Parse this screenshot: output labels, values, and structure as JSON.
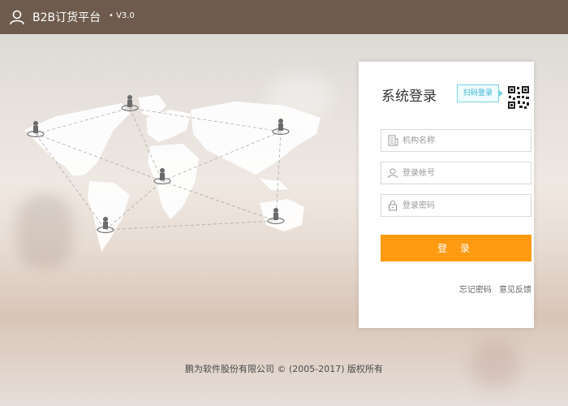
{
  "header": {
    "title": "B2B订货平台",
    "version": "• V3.0",
    "icon": "user-icon"
  },
  "login": {
    "title": "系统登录",
    "qr_tag": "扫码登录",
    "org_placeholder": "机构名称",
    "account_placeholder": "登录帐号",
    "password_placeholder": "登录密码",
    "login_button": "登 录",
    "forgot_password": "忘记密码",
    "feedback": "意见反馈"
  },
  "footer": {
    "copyright": "鹏为软件股份有限公司 © (2005-2017) 版权所有"
  },
  "colors": {
    "header_bg": "#6e5b4d",
    "accent": "#ff9a12",
    "qr_tag": "#3bb6d1"
  }
}
